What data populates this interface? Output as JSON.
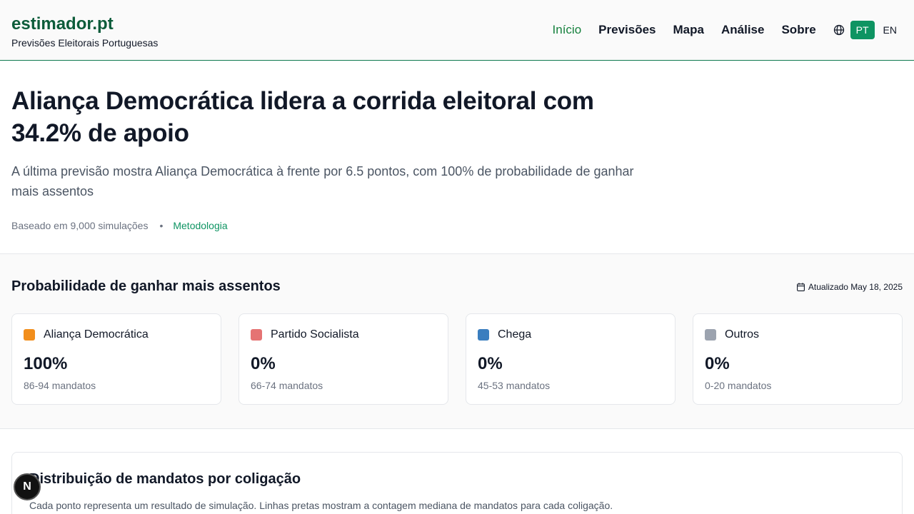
{
  "header": {
    "brand": "estimador.pt",
    "tagline": "Previsões Eleitorais Portuguesas",
    "nav": [
      "Início",
      "Previsões",
      "Mapa",
      "Análise",
      "Sobre"
    ],
    "lang_pt": "PT",
    "lang_en": "EN"
  },
  "hero": {
    "title": "Aliança Democrática lidera a corrida eleitoral com 34.2% de apoio",
    "subtitle": "A última previsão mostra Aliança Democrática à frente por 6.5 pontos, com 100% de probabilidade de ganhar mais assentos",
    "simulations": "Baseado em 9,000 simulações",
    "separator": "•",
    "methodology": "Metodologia"
  },
  "probability": {
    "title": "Probabilidade de ganhar mais assentos",
    "updated": "Atualizado May 18, 2025",
    "cards": [
      {
        "name": "Aliança Democrática",
        "pct": "100%",
        "seats": "86-94 mandatos",
        "color": "#f28e1c"
      },
      {
        "name": "Partido Socialista",
        "pct": "0%",
        "seats": "66-74 mandatos",
        "color": "#e57373"
      },
      {
        "name": "Chega",
        "pct": "0%",
        "seats": "45-53 mandatos",
        "color": "#3a7ebf"
      },
      {
        "name": "Outros",
        "pct": "0%",
        "seats": "0-20 mandatos",
        "color": "#9ca3af"
      }
    ]
  },
  "distribution": {
    "title": "Distribuição de mandatos por coligação",
    "description": "Cada ponto representa um resultado de simulação. Linhas pretas mostram a contagem mediana de mandatos para cada coligação."
  },
  "fab": {
    "label": "N"
  }
}
